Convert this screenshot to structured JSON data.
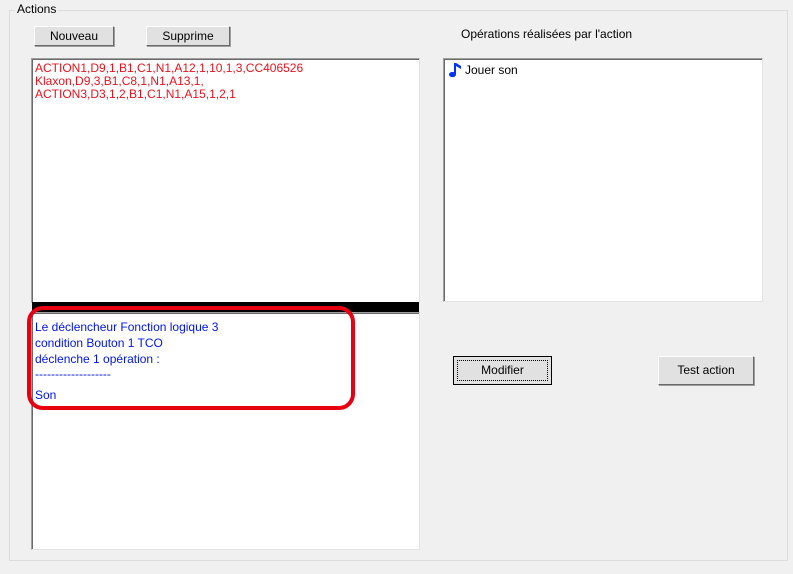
{
  "group": {
    "title": "Actions"
  },
  "toolbar": {
    "new_label": "Nouveau",
    "delete_label": "Supprime"
  },
  "actions_list": {
    "items": [
      "ACTION1,D9,1,B1,C1,N1,A12,1,10,1,3,CC406526",
      "Klaxon,D9,3,B1,C8,1,N1,A13,1,",
      "ACTION3,D3,1,2,B1,C1,N1,A15,1,2,1"
    ],
    "text_color": "#e8121e"
  },
  "description": {
    "lines": [
      "Le déclencheur Fonction logique 3",
      "condition Bouton 1 TCO",
      "déclenche 1 opération :",
      "-------------------",
      "Son"
    ],
    "text_color": "#0014e6",
    "highlight_color": "#e60012"
  },
  "operations": {
    "label": "Opérations réalisées par l'action",
    "items": [
      {
        "icon": "music-note-icon",
        "label": "Jouer son"
      }
    ],
    "icon_color": "#0033ff"
  },
  "buttons": {
    "modify_label": "Modifier",
    "test_label": "Test action"
  }
}
